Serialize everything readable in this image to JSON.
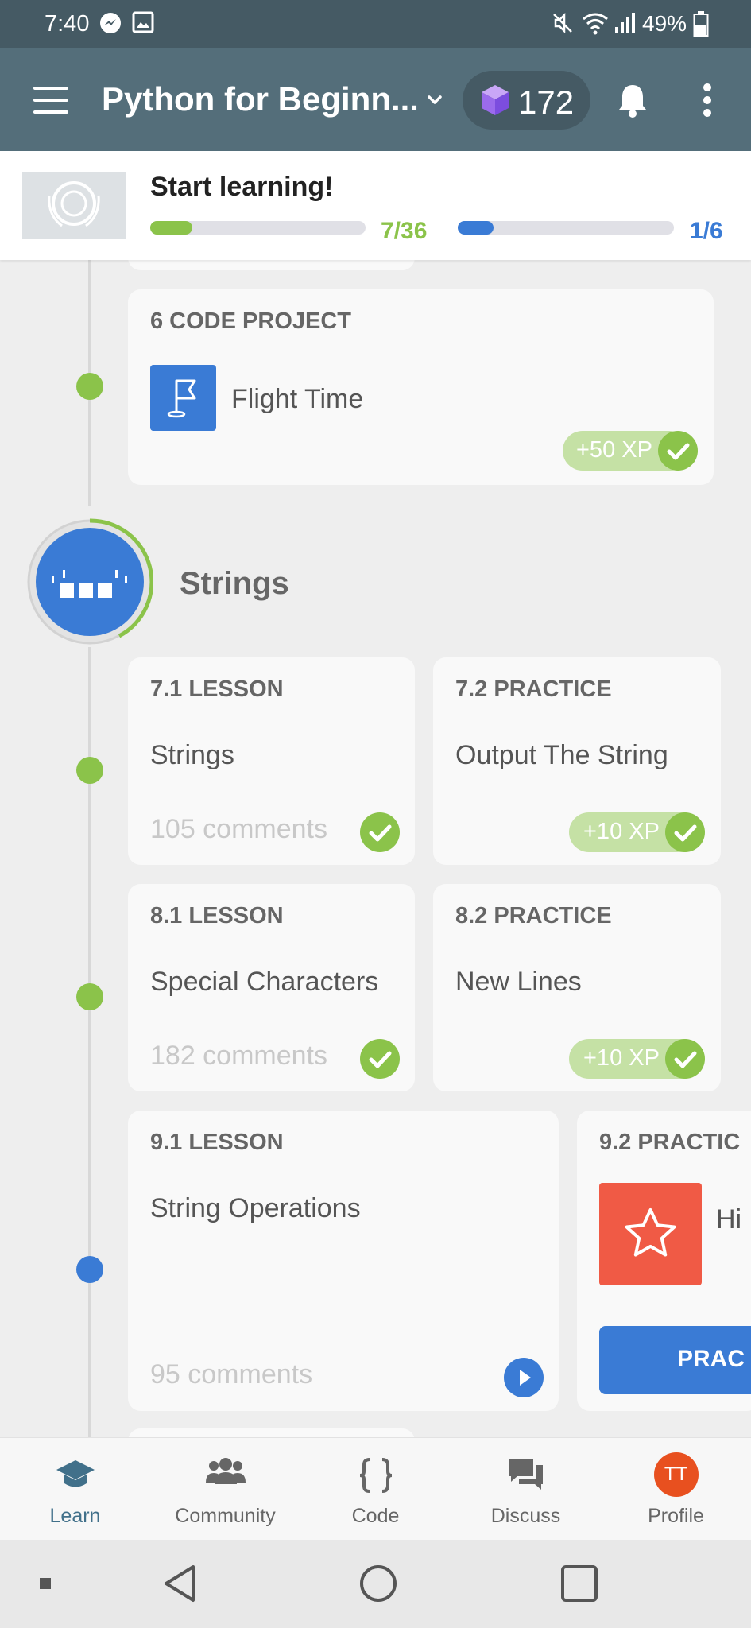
{
  "status_bar": {
    "time": "7:40",
    "battery": "49%"
  },
  "app_bar": {
    "course_title": "Python for Beginn...",
    "gems": "172"
  },
  "progress": {
    "heading": "Start learning!",
    "lessons_count": "7/36",
    "lessons_fraction": 0.194,
    "modules_count": "1/6",
    "modules_fraction": 0.167
  },
  "code_project": {
    "kind": "6 CODE PROJECT",
    "title": "Flight Time",
    "xp": "+50 XP"
  },
  "section": {
    "title": "Strings"
  },
  "lessons": {
    "l71": {
      "kind": "7.1 LESSON",
      "title": "Strings",
      "comments": "105 comments"
    },
    "p72": {
      "kind": "7.2 PRACTICE",
      "title": "Output The String",
      "xp": "+10 XP"
    },
    "l81": {
      "kind": "8.1 LESSON",
      "title": "Special Characters",
      "comments": "182 comments"
    },
    "p82": {
      "kind": "8.2 PRACTICE",
      "title": "New Lines",
      "xp": "+10 XP"
    },
    "l91": {
      "kind": "9.1 LESSON",
      "title": "String Operations",
      "comments": "95 comments"
    },
    "p92": {
      "kind": "9.2 PRACTIC",
      "title": "Hi",
      "button": "PRAC"
    }
  },
  "bottom_nav": {
    "learn": "Learn",
    "community": "Community",
    "code": "Code",
    "discuss": "Discuss",
    "profile": "Profile",
    "avatar_initials": "TT"
  },
  "colors": {
    "status_bar": "#455a64",
    "app_bar": "#546e7a",
    "green": "#8bc34a",
    "blue": "#3a7bd5",
    "practice_red": "#f05a45",
    "avatar": "#e8501f"
  },
  "icons": [
    "menu-icon",
    "chevron-down-icon",
    "gem-icon",
    "bell-icon",
    "more-icon",
    "flag-icon",
    "check-icon",
    "play-icon",
    "star-icon",
    "graduation-cap-icon",
    "community-icon",
    "code-braces-icon",
    "chat-icon",
    "back-icon",
    "home-icon",
    "recents-icon"
  ]
}
